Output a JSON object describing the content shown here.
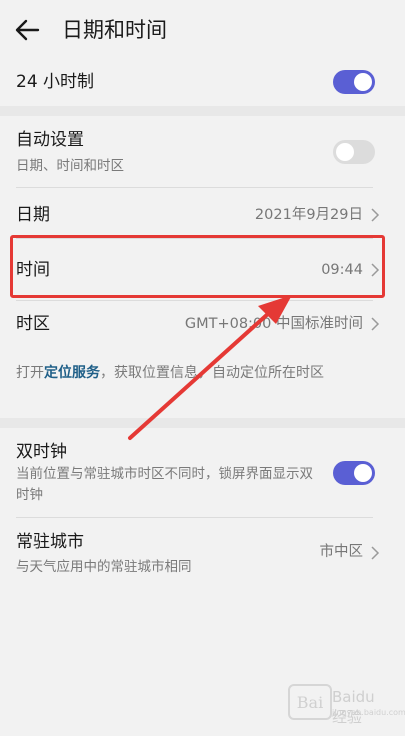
{
  "header": {
    "title": "日期和时间",
    "back_icon": "arrow-left-icon"
  },
  "clock24": {
    "label": "24 小时制",
    "enabled": true
  },
  "auto_set": {
    "label": "自动设置",
    "sub": "日期、时间和时区",
    "enabled": false
  },
  "date": {
    "label": "日期",
    "value": "2021年9月29日"
  },
  "time": {
    "label": "时间",
    "value": "09:44"
  },
  "timezone": {
    "label": "时区",
    "value": "GMT+08:00 中国标准时间"
  },
  "location_info": {
    "prefix": "打开",
    "link": "定位服务",
    "suffix": "，获取位置信息，自动定位所在时区"
  },
  "dual_clock": {
    "label": "双时钟",
    "sub": "当前位置与常驻城市时区不同时，锁屏界面显示双时钟",
    "enabled": true
  },
  "home_city": {
    "label": "常驻城市",
    "sub": "与天气应用中的常驻城市相同",
    "value": "市中区"
  },
  "watermark": {
    "logo": "Bai",
    "text": "Baidu 经验",
    "sub": "jingyan.baidu.com"
  },
  "colors": {
    "accent": "#5a5fd4",
    "highlight": "#e53935",
    "link": "#1f5f88"
  }
}
